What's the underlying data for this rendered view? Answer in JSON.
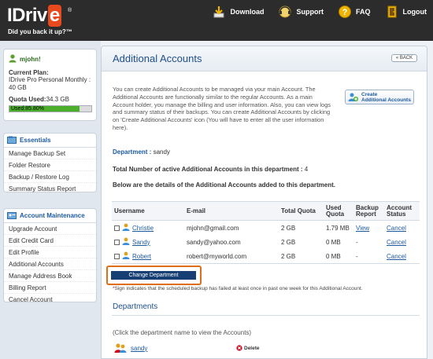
{
  "brand": {
    "logo_text": "IDriv",
    "logo_e": "e",
    "reg": "®",
    "tagline": "Did you back it up?™"
  },
  "topnav": [
    {
      "label": "Download",
      "icon": "download-icon"
    },
    {
      "label": "Support",
      "icon": "support-icon"
    },
    {
      "label": "FAQ",
      "icon": "faq-icon"
    },
    {
      "label": "Logout",
      "icon": "logout-icon"
    }
  ],
  "user": {
    "name": "mjohn!",
    "plan_label": "Current Plan:",
    "plan_value": "IDrive Pro Personal Monthly : 40 GB",
    "quota_label": "Quota Used:",
    "quota_value": "34.3 GB",
    "used_text": "Used:85.80%",
    "used_fraction": 0.858
  },
  "essentials": {
    "title": "Essentials",
    "items": [
      "Manage Backup Set",
      "Folder Restore",
      "Backup / Restore Log",
      "Summary Status Report"
    ]
  },
  "account_maintenance": {
    "title": "Account Maintenance",
    "items": [
      "Upgrade Account",
      "Edit Credit Card",
      "Edit Profile",
      "Additional Accounts",
      "Manage Address Book",
      "Billing Report",
      "Cancel Account"
    ]
  },
  "main": {
    "title": "Additional Accounts",
    "back_label": "« BACK",
    "intro": "You can create Additional Accounts to be managed via your main Account. The Additional Accounts are functionally similar to the regular Accounts. As a main Account holder, you manage the billing and user information. Also, you can view logs and summary status of their backups. You can create Additional Accounts by clicking on 'Create Additional Accounts' icon (You will have to enter all the user information here).",
    "create_label_1": "Create",
    "create_label_2": "Additional Accounts",
    "department_label": "Department :",
    "department_value": "sandy",
    "total_label": "Total Number of active Additional Accounts in this department :",
    "total_value": "4",
    "below_text": "Below are the details of the Additional Accounts added to this department."
  },
  "table": {
    "headers": [
      "Username",
      "E-mail",
      "Total Quota",
      "Used Quota",
      "Backup Report",
      "Account Status"
    ],
    "rows": [
      {
        "username": "Christie",
        "email": "mjohn@gmail.com",
        "total": "2 GB",
        "used": "1.79 MB",
        "report": "View",
        "status": "Cancel"
      },
      {
        "username": "Sandy",
        "email": "sandy@yahoo.com",
        "total": "2 GB",
        "used": "0 MB",
        "report": "-",
        "status": "Cancel"
      },
      {
        "username": "Robert",
        "email": "robert@myworld.com",
        "total": "2 GB",
        "used": "0 MB",
        "report": "-",
        "status": "Cancel"
      }
    ]
  },
  "change_department_label": "Change Department",
  "sign_note_star": "*",
  "sign_note": "Sign indicates that the scheduled backup has failed at least once in past one week for this Additional Account.",
  "departments": {
    "title": "Departments",
    "help": "(Click the department name to view the Accounts)",
    "items": [
      {
        "name": "sandy",
        "delete_label": "Delete"
      }
    ]
  },
  "colors": {
    "accent": "#1e5aa0",
    "highlight": "#e06e17",
    "usage_fill": "#4caf2c",
    "topbar": "#2c2c2c"
  }
}
